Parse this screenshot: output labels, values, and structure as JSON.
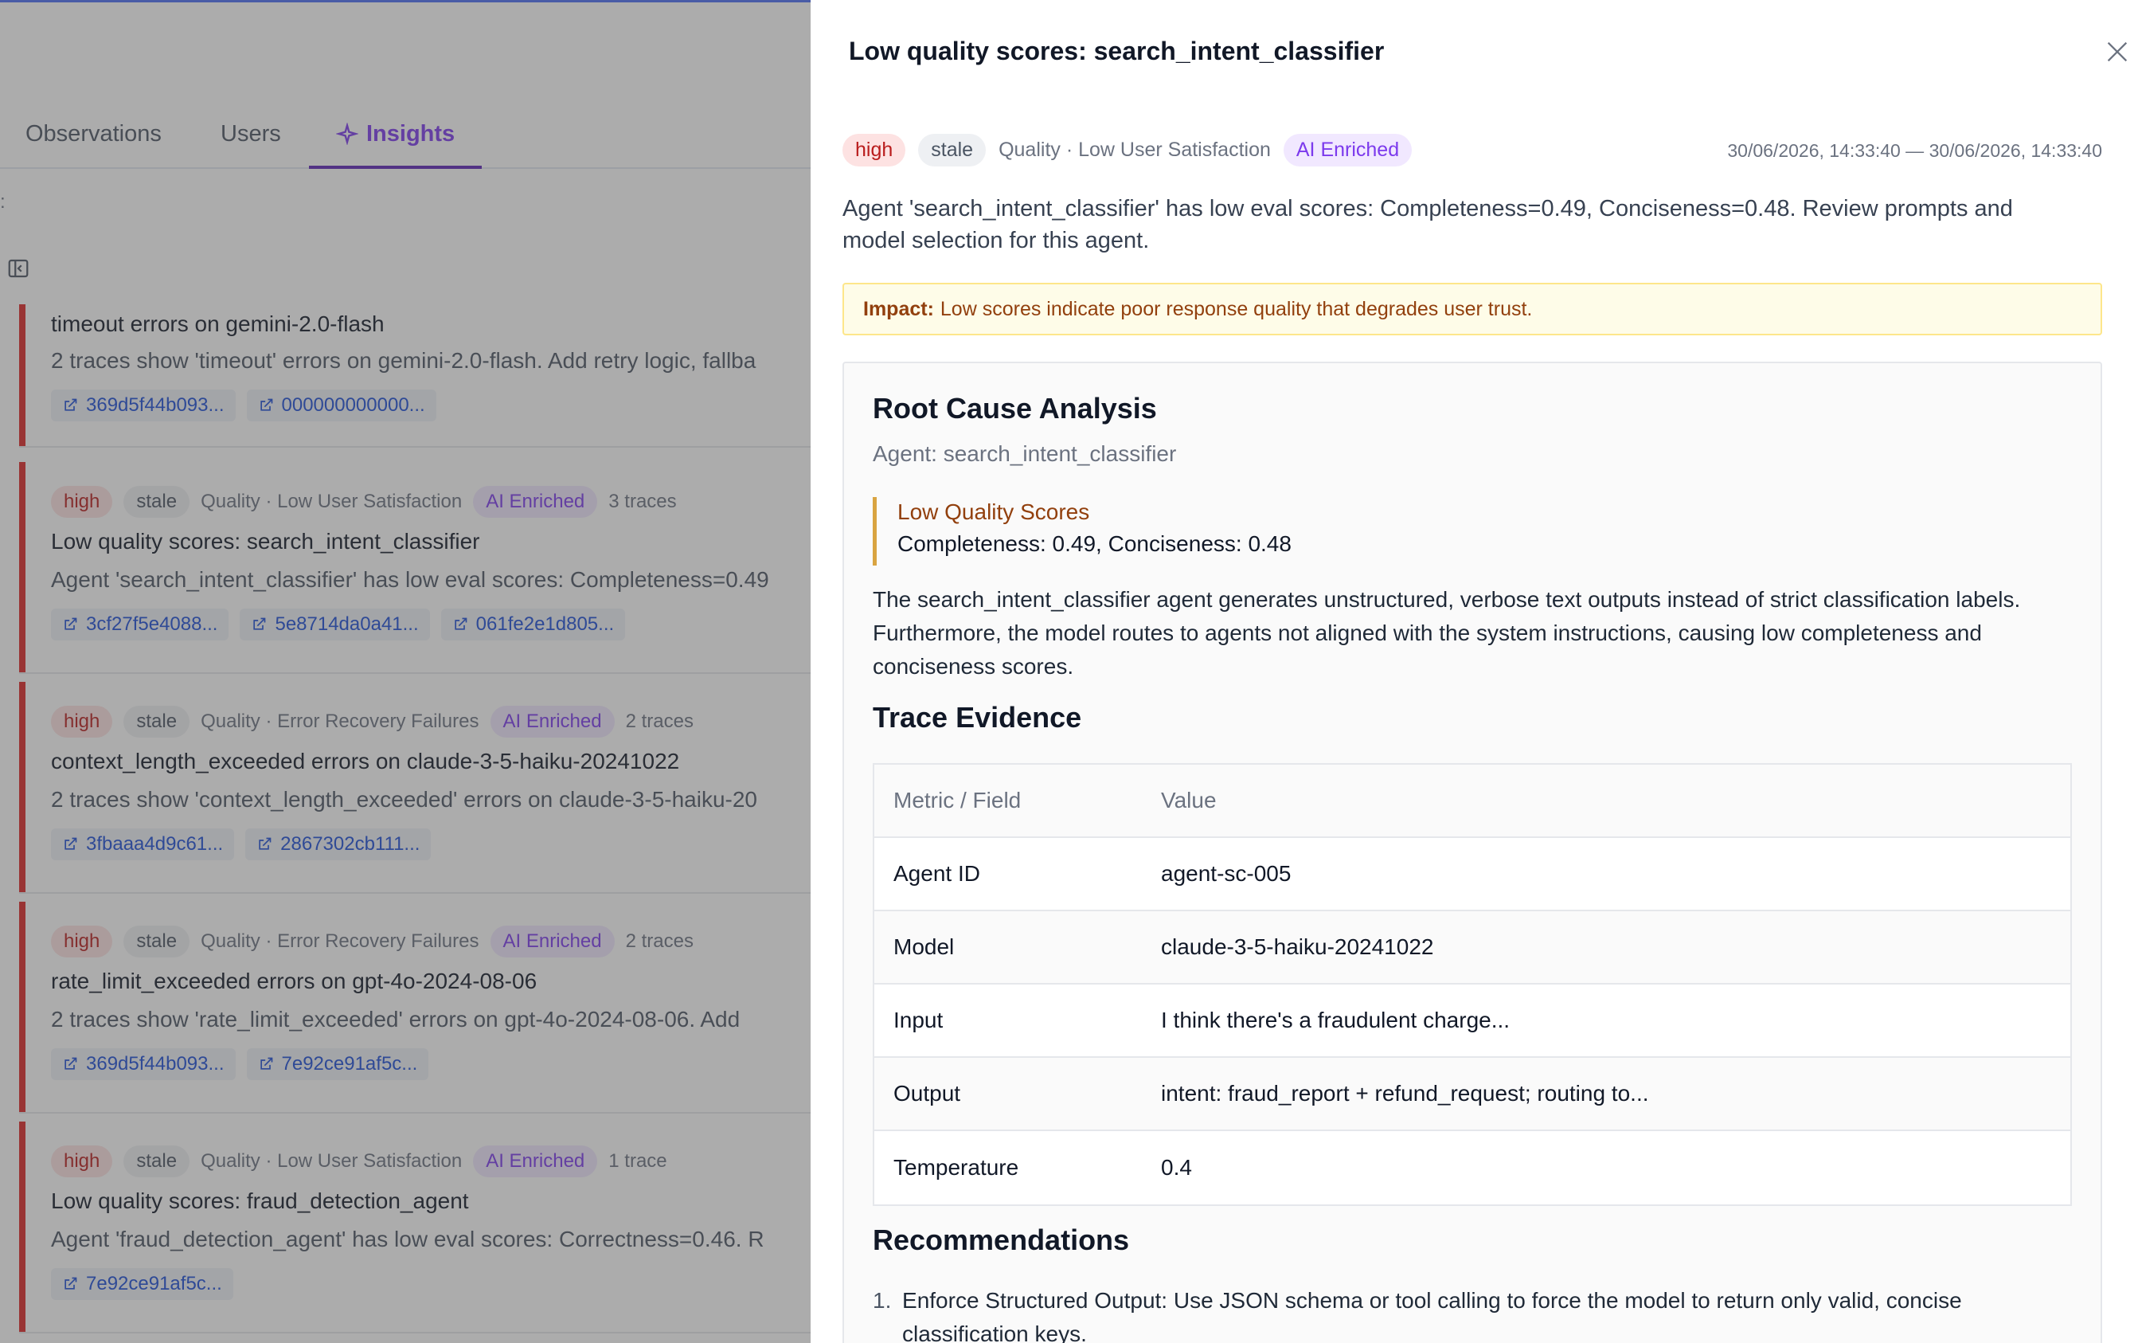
{
  "tabs": [
    {
      "label": "Observations"
    },
    {
      "label": "Users"
    },
    {
      "label": "Insights"
    }
  ],
  "insights": [
    {
      "title": "timeout errors on gemini-2.0-flash",
      "description": "2 traces show 'timeout' errors on gemini-2.0-flash. Add retry logic, fallba",
      "traces": [
        "369d5f44b093...",
        "000000000000..."
      ]
    },
    {
      "severity": "high",
      "status": "stale",
      "category": "Quality · Low User Satisfaction",
      "enriched": "AI Enriched",
      "trace_count": "3 traces",
      "title": "Low quality scores: search_intent_classifier",
      "description": "Agent 'search_intent_classifier' has low eval scores: Completeness=0.49",
      "traces": [
        "3cf27f5e4088...",
        "5e8714da0a41...",
        "061fe2e1d805..."
      ]
    },
    {
      "severity": "high",
      "status": "stale",
      "category": "Quality · Error Recovery Failures",
      "enriched": "AI Enriched",
      "trace_count": "2 traces",
      "title": "context_length_exceeded errors on claude-3-5-haiku-20241022",
      "description": "2 traces show 'context_length_exceeded' errors on claude-3-5-haiku-20",
      "traces": [
        "3fbaaa4d9c61...",
        "2867302cb111..."
      ]
    },
    {
      "severity": "high",
      "status": "stale",
      "category": "Quality · Error Recovery Failures",
      "enriched": "AI Enriched",
      "trace_count": "2 traces",
      "title": "rate_limit_exceeded errors on gpt-4o-2024-08-06",
      "description": "2 traces show 'rate_limit_exceeded' errors on gpt-4o-2024-08-06. Add",
      "traces": [
        "369d5f44b093...",
        "7e92ce91af5c..."
      ]
    },
    {
      "severity": "high",
      "status": "stale",
      "category": "Quality · Low User Satisfaction",
      "enriched": "AI Enriched",
      "trace_count": "1 trace",
      "title": "Low quality scores: fraud_detection_agent",
      "description": "Agent 'fraud_detection_agent' has low eval scores: Correctness=0.46. R",
      "traces": [
        "7e92ce91af5c..."
      ]
    }
  ],
  "drawer": {
    "title": "Low quality scores: search_intent_classifier",
    "severity": "high",
    "status": "stale",
    "category": "Quality · Low User Satisfaction",
    "enriched": "AI Enriched",
    "time_range": "30/06/2026, 14:33:40 — 30/06/2026, 14:33:40",
    "description": "Agent 'search_intent_classifier' has low eval scores: Completeness=0.49, Conciseness=0.48. Review prompts and model selection for this agent.",
    "impact_label": "Impact:",
    "impact_text": "Low scores indicate poor response quality that degrades user trust.",
    "rca": {
      "heading": "Root Cause Analysis",
      "agent_line": "Agent: search_intent_classifier",
      "callout_title": "Low Quality Scores",
      "callout_body": "Completeness: 0.49, Conciseness: 0.48",
      "paragraph": "The search_intent_classifier agent generates unstructured, verbose text outputs instead of strict classification labels. Furthermore, the model routes to agents not aligned with the system instructions, causing low completeness and conciseness scores.",
      "evidence_heading": "Trace Evidence",
      "table_headers": [
        "Metric / Field",
        "Value"
      ],
      "table_rows": [
        [
          "Agent ID",
          "agent-sc-005"
        ],
        [
          "Model",
          "claude-3-5-haiku-20241022"
        ],
        [
          "Input",
          "I think there's a fraudulent charge..."
        ],
        [
          "Output",
          "intent: fraud_report + refund_request; routing to..."
        ],
        [
          "Temperature",
          "0.4"
        ]
      ],
      "recommendations_heading": "Recommendations",
      "recommendations": [
        {
          "num": "1.",
          "text": "Enforce Structured Output: Use JSON schema or tool calling to force the model to return only valid, concise classification keys."
        }
      ]
    }
  }
}
